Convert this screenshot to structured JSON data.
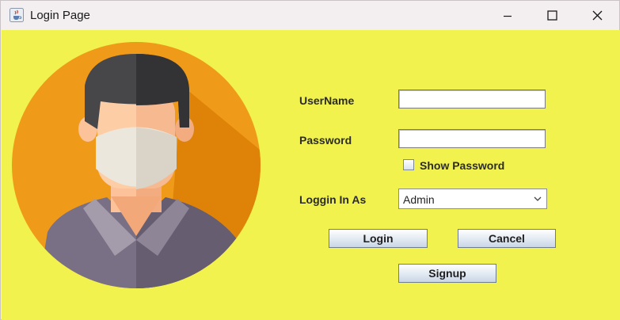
{
  "window": {
    "title": "Login Page",
    "minimize_icon": "minimize-icon",
    "maximize_icon": "maximize-icon",
    "close_icon": "close-icon",
    "app_icon": "java-coffee-icon"
  },
  "colors": {
    "background": "#f1f24e",
    "avatar_circle": "#f09a1a",
    "avatar_shadow": "#d9820b",
    "hair": "#3c3c3e",
    "skin": "#fcc9a0",
    "mask": "#ebe6dc",
    "shirt": "#7a6f7f"
  },
  "form": {
    "username_label": "UserName",
    "username_value": "",
    "password_label": "Password",
    "password_value": "",
    "show_password_label": "Show Password",
    "show_password_checked": false,
    "login_as_label": "Loggin In As",
    "login_as_selected": "Admin"
  },
  "buttons": {
    "login": "Login",
    "cancel": "Cancel",
    "signup": "Signup"
  },
  "avatar": {
    "icon": "user-avatar-masked-icon"
  }
}
